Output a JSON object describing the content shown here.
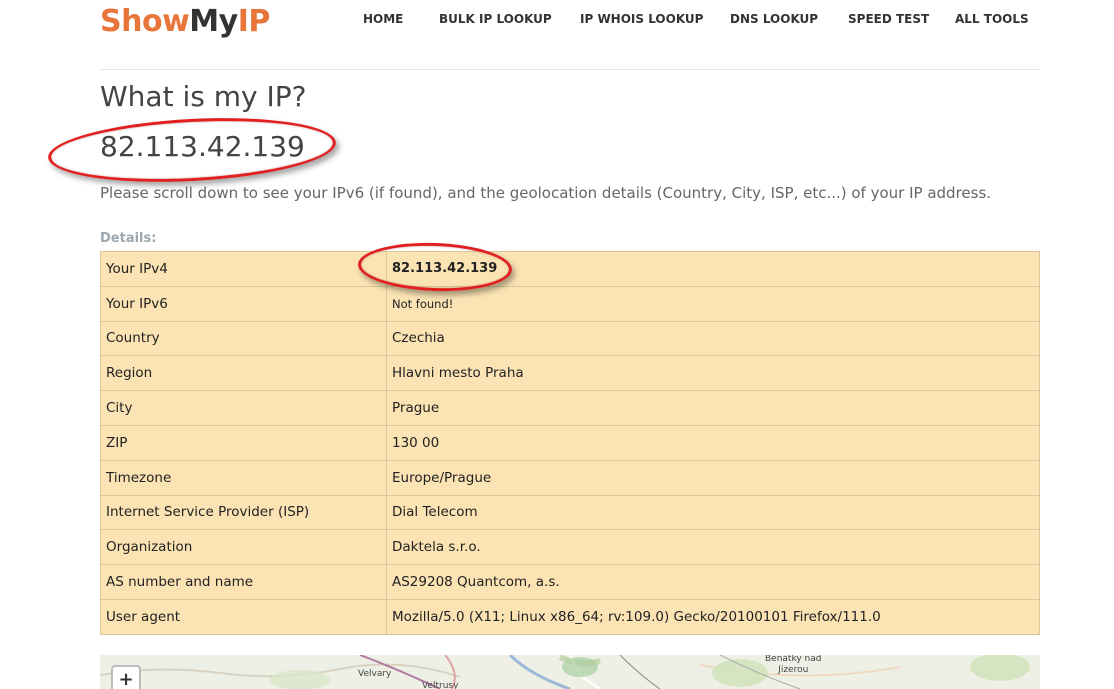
{
  "brand": {
    "part1": "Show",
    "part2": "My",
    "part3": "IP"
  },
  "nav": {
    "home": "HOME",
    "bulk_ip_lookup": "BULK IP LOOKUP",
    "ip_whois_lookup": "IP WHOIS LOOKUP",
    "dns_lookup": "DNS LOOKUP",
    "speed_test": "SPEED TEST",
    "all_tools": "ALL TOOLS"
  },
  "page": {
    "title": "What is my IP?",
    "ip_address": "82.113.42.139",
    "intro": "Please scroll down to see your IPv6 (if found), and the geolocation details (Country, City, ISP, etc...) of your IP address.",
    "details_label": "Details:"
  },
  "details": [
    {
      "label": "Your IPv4",
      "value": "82.113.42.139"
    },
    {
      "label": "Your IPv6",
      "value": "Not found!"
    },
    {
      "label": "Country",
      "value": "Czechia"
    },
    {
      "label": "Region",
      "value": "Hlavni mesto Praha"
    },
    {
      "label": "City",
      "value": "Prague"
    },
    {
      "label": "ZIP",
      "value": "130 00"
    },
    {
      "label": "Timezone",
      "value": "Europe/Prague"
    },
    {
      "label": "Internet Service Provider (ISP)",
      "value": "Dial Telecom"
    },
    {
      "label": "Organization",
      "value": "Daktela s.r.o."
    },
    {
      "label": "AS number and name",
      "value": "AS29208 Quantcom, a.s."
    },
    {
      "label": "User agent",
      "value": "Mozilla/5.0 (X11; Linux x86_64; rv:109.0) Gecko/20100101 Firefox/111.0"
    }
  ],
  "map": {
    "zoom_in": "+",
    "labels": {
      "velvary": "Velvary",
      "veltrusy": "Veltrusy",
      "benatky": "Benátky nad\nJizerou"
    }
  },
  "colors": {
    "brand_orange": "#e8753a",
    "table_bg": "#fbe3b4",
    "highlight_ring": "#e02020"
  }
}
